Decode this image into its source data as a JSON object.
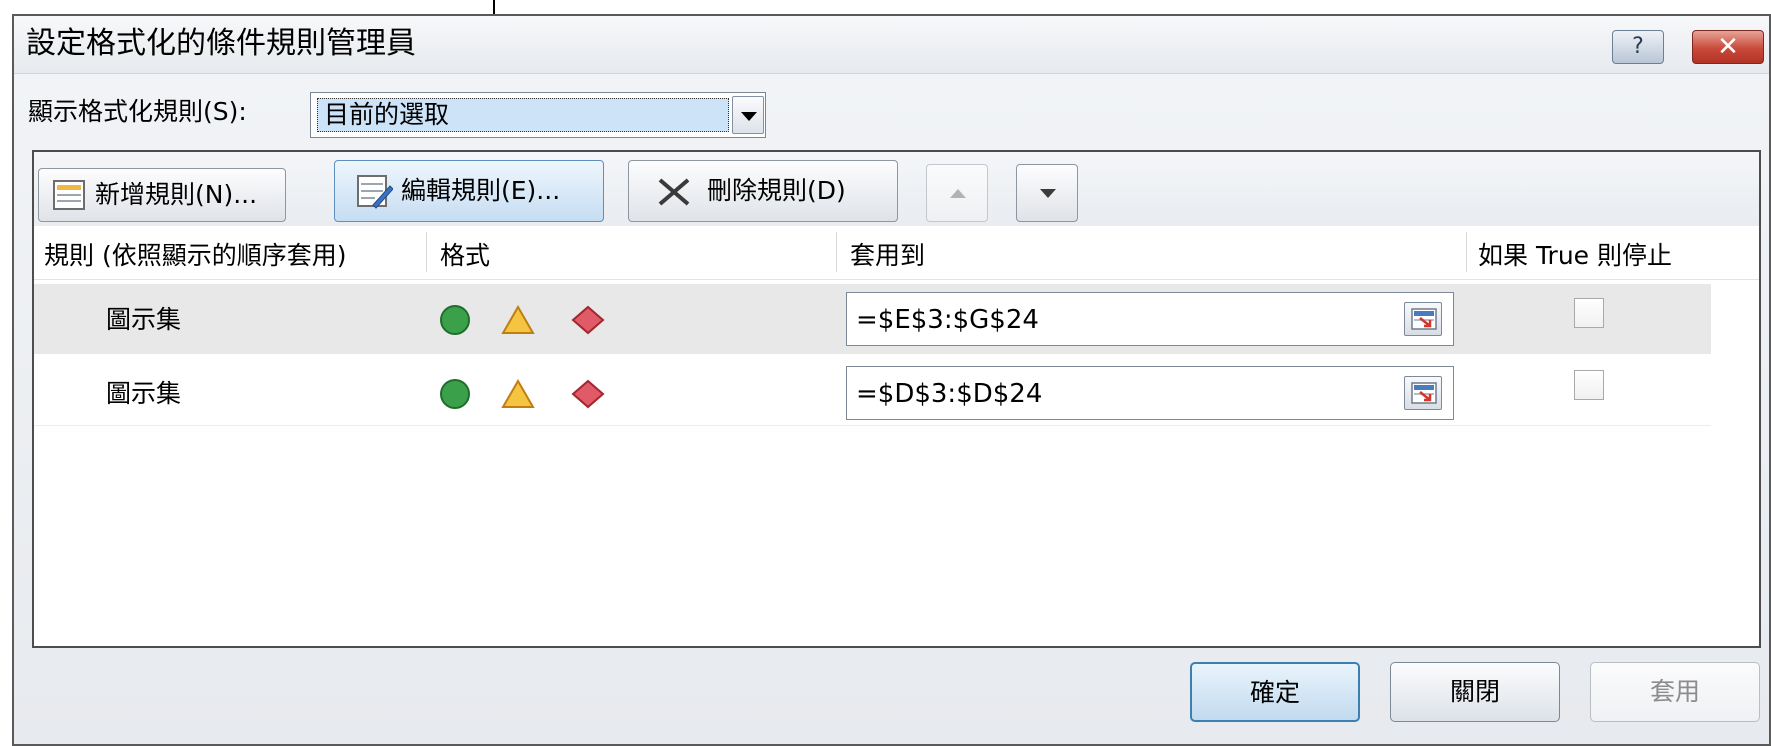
{
  "dialog": {
    "title": "設定格式化的條件規則管理員",
    "help_label": "?",
    "close_label": "✕"
  },
  "show_rules": {
    "label": "顯示格式化規則(S):",
    "value": "目前的選取"
  },
  "toolbar": {
    "new_rule": "新增規則(N)...",
    "edit_rule": "編輯規則(E)...",
    "delete_rule": "刪除規則(D)",
    "move_up_icon": "triangle-up-icon",
    "move_down_icon": "triangle-down-icon"
  },
  "table": {
    "columns": [
      "規則 (依照顯示的順序套用)",
      "格式",
      "套用到",
      "如果 True 則停止"
    ],
    "rows": [
      {
        "rule": "圖示集",
        "applies_to": "=$E$3:$G$24",
        "stop_if_true": false,
        "selected": true
      },
      {
        "rule": "圖示集",
        "applies_to": "=$D$3:$D$24",
        "stop_if_true": false,
        "selected": false
      }
    ],
    "format_icons": [
      "green-circle-icon",
      "yellow-triangle-icon",
      "red-diamond-icon"
    ]
  },
  "footer": {
    "ok": "確定",
    "close": "關閉",
    "apply": "套用"
  },
  "colors": {
    "selected_row": "#e8e8e8",
    "selection_highlight": "#cde3f7",
    "close_button": "#c9493a"
  }
}
